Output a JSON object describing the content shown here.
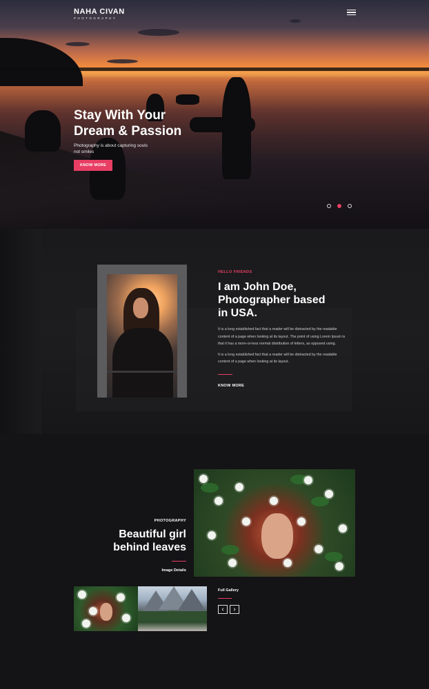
{
  "brand": {
    "name": "NAHA CIVAN",
    "tagline": "PHOTOGRAPHY"
  },
  "hero": {
    "title": "Stay With Your\nDream & Passion",
    "subtitle": "Photography is about capturing souls not smiles",
    "button_label": "KNOW MORE",
    "slides": 3,
    "active_slide": 2
  },
  "about": {
    "eyebrow": "HELLO FRIENDS",
    "title": "I am John Doe,\nPhotographer based\nin USA.",
    "paragraph1": "It is a long established fact that a reader will be distracted by the readable content of a page when looking at its layout. The point of using Lorem Ipsum is that it has a more-or-less normal distribution of letters, as opposed using.",
    "paragraph2": "It is a long established fact that a reader will be distracted by the readable content of a page when looking at its layout.",
    "link_label": "KNOW MORE"
  },
  "gallery": {
    "category": "PHOTOGRAPHY",
    "title": "Beautiful girl\nbehind leaves",
    "details_link": "Image Details",
    "full_gallery_label": "Full Gallery",
    "prev_icon": "‹",
    "next_icon": "›"
  },
  "colors": {
    "accent": "#e83e64",
    "background": "#141316"
  }
}
